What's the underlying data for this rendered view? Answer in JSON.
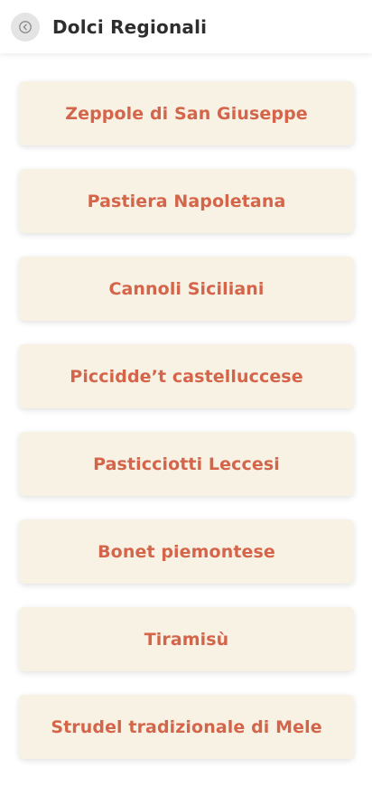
{
  "header": {
    "title": "Dolci Regionali",
    "back_icon": "chevron-left-icon"
  },
  "colors": {
    "accent": "#d4644a",
    "card_background": "#f7f2e4",
    "back_button_background": "#e4e4e4"
  },
  "items": [
    {
      "label": "Zeppole di San Giuseppe"
    },
    {
      "label": "Pastiera Napoletana"
    },
    {
      "label": "Cannoli Siciliani"
    },
    {
      "label": "Piccidde’t castelluccese"
    },
    {
      "label": "Pasticciotti Leccesi"
    },
    {
      "label": "Bonet piemontese"
    },
    {
      "label": "Tiramisù"
    },
    {
      "label": "Strudel tradizionale di Mele"
    }
  ]
}
